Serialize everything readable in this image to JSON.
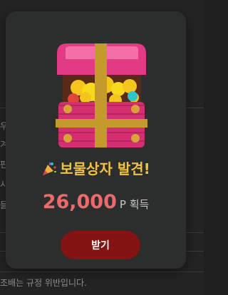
{
  "background": {
    "side_chars": [
      "우",
      "겨",
      "핀",
      "시",
      "들"
    ],
    "footer_text": "조배는 규정 위반입니다."
  },
  "modal": {
    "icon": "treasure-chest-icon",
    "title_icon": "party-popper-icon",
    "title": "보물상자 발견!",
    "reward_amount": "26,000",
    "reward_unit": "P 획득",
    "button_label": "받기"
  },
  "colors": {
    "title": "#f0c23f",
    "amount": "#ee6a6a",
    "button": "#841313",
    "modal_bg": "#2c2d2d"
  }
}
